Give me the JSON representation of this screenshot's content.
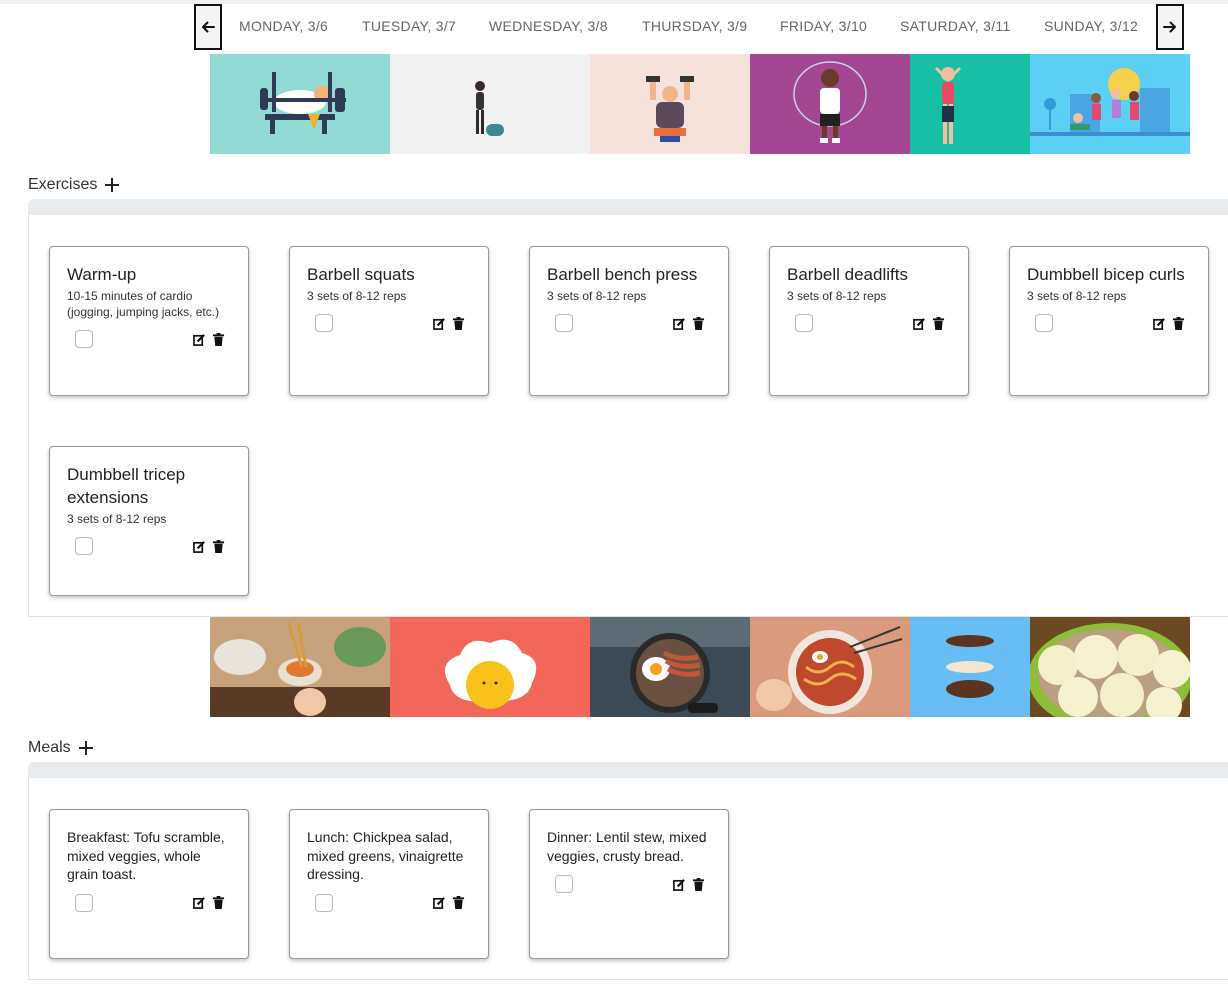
{
  "nav": {
    "prev_icon": "arrow-left-icon",
    "next_icon": "arrow-right-icon",
    "days": [
      "MONDAY, 3/6",
      "TUESDAY, 3/7",
      "WEDNESDAY, 3/8",
      "THURSDAY, 3/9",
      "FRIDAY, 3/10",
      "SATURDAY, 3/11",
      "SUNDAY, 3/12"
    ]
  },
  "exercise_images": [
    {
      "name": "bench-press-illustration",
      "bg": "#92dbd5"
    },
    {
      "name": "yoga-mat-illustration",
      "bg": "#f1f1f1"
    },
    {
      "name": "dumbbell-press-illustration",
      "bg": "#f5e3db"
    },
    {
      "name": "jump-rope-illustration",
      "bg": "#a34693"
    },
    {
      "name": "stretching-illustration",
      "bg": "#17bfa4"
    },
    {
      "name": "group-workout-illustration",
      "bg": "#5ccff5"
    }
  ],
  "exercises": {
    "title": "Exercises",
    "add_icon": "plus-icon",
    "items": [
      {
        "title": "Warm-up",
        "detail": "10-15 minutes of cardio (jogging, jumping jacks, etc.)"
      },
      {
        "title": "Barbell squats",
        "detail": "3 sets of 8-12 reps"
      },
      {
        "title": "Barbell bench press",
        "detail": "3 sets of 8-12 reps"
      },
      {
        "title": "Barbell deadlifts",
        "detail": "3 sets of 8-12 reps"
      },
      {
        "title": "Dumbbell bicep curls",
        "detail": "3 sets of 8-12 reps"
      },
      {
        "title": "Dumbbell tricep extensions",
        "detail": "3 sets of 8-12 reps"
      }
    ]
  },
  "meal_images": [
    {
      "name": "noodle-cooking-illustration",
      "bg": "#c8a27a"
    },
    {
      "name": "fried-egg-illustration",
      "bg": "#f3665a"
    },
    {
      "name": "bacon-and-egg-pan-illustration",
      "bg": "#3c4a56"
    },
    {
      "name": "ramen-bowl-illustration",
      "bg": "#d99a7e"
    },
    {
      "name": "burger-stack-illustration",
      "bg": "#68bdf4"
    },
    {
      "name": "dumplings-illustration",
      "bg": "#6b4a22"
    }
  ],
  "meals": {
    "title": "Meals",
    "add_icon": "plus-icon",
    "items": [
      {
        "text": "Breakfast: Tofu scramble, mixed veggies, whole grain toast."
      },
      {
        "text": "Lunch: Chickpea salad, mixed greens, vinaigrette dressing."
      },
      {
        "text": "Dinner: Lentil stew, mixed veggies, crusty bread."
      }
    ]
  },
  "card_icons": {
    "edit": "edit-icon",
    "delete": "trash-icon"
  }
}
